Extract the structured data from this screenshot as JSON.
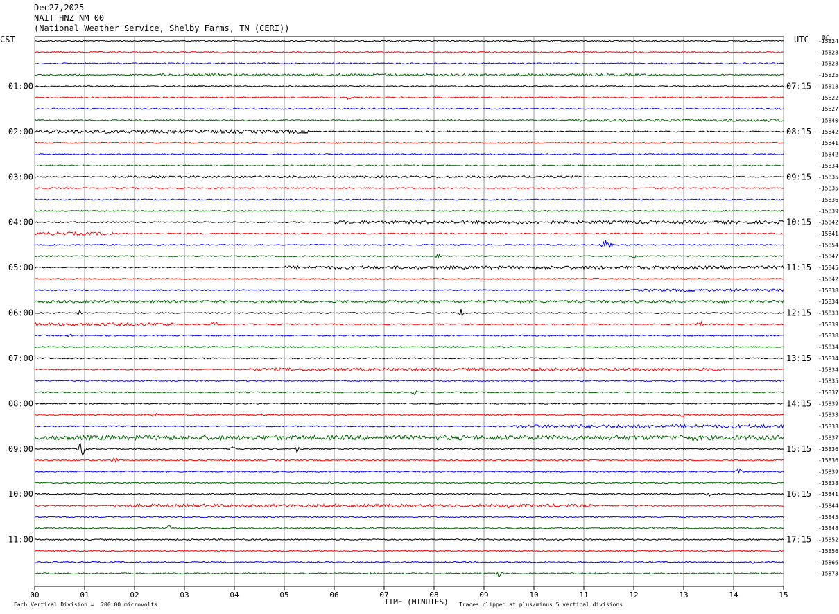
{
  "header": {
    "date": "Dec27,2025",
    "station": "NAIT HNZ NM 00",
    "location": "(National Weather Service, Shelby Farms, TN (CERI))"
  },
  "axes": {
    "left_tz": "CST",
    "right_tz": "UTC",
    "right_sub": "DC"
  },
  "footer": {
    "division_note": "Each Vertical Division =  200.00 microvolts",
    "xlabel": "TIME (MINUTES)",
    "clip_note": "Traces clipped at plus/minus 5 vertical divisions"
  },
  "colors": {
    "palette": [
      "#000000",
      "#ff0000",
      "#0000ff",
      "#006400"
    ],
    "grid": "#808080"
  },
  "chart_data": {
    "type": "seismogram",
    "xlabel": "TIME (MINUTES)",
    "x_ticks": [
      "00",
      "01",
      "02",
      "03",
      "04",
      "05",
      "06",
      "07",
      "08",
      "09",
      "10",
      "11",
      "12",
      "13",
      "14",
      "15"
    ],
    "x_range": [
      0,
      15
    ],
    "traces_per_hour": 4,
    "left_hour_labels": [
      "01:00",
      "02:00",
      "03:00",
      "04:00",
      "05:00",
      "06:00",
      "07:00",
      "08:00",
      "09:00",
      "10:00",
      "11:00"
    ],
    "right_hour_labels": [
      "07:15",
      "08:15",
      "09:15",
      "10:15",
      "11:15",
      "12:15",
      "13:15",
      "14:15",
      "15:15",
      "16:15",
      "17:15"
    ],
    "dc_offsets": [
      -15824,
      -15828,
      -15828,
      -15825,
      -15818,
      -15822,
      -15827,
      -15840,
      -15842,
      -15841,
      -15842,
      -15834,
      -15835,
      -15835,
      -15836,
      -15839,
      -15842,
      -15841,
      -15854,
      -15847,
      -15845,
      -15842,
      -15838,
      -15834,
      -15833,
      -15839,
      -15838,
      -15834,
      -15834,
      -15834,
      -15835,
      -15837,
      -15839,
      -15833,
      -15833,
      -15837,
      -15836,
      -15836,
      -15839,
      -15838,
      -15841,
      -15844,
      -15845,
      -15848,
      -15852,
      -15856,
      -15866,
      -15873
    ],
    "events": [
      {
        "trace": 3,
        "start": 2.5,
        "end": 12.5,
        "amp": 0.22
      },
      {
        "trace": 5,
        "start": 6.2,
        "end": 6.4,
        "amp": 0.5
      },
      {
        "trace": 7,
        "start": 10.8,
        "end": 15,
        "amp": 0.25
      },
      {
        "trace": 8,
        "start": 0,
        "end": 5.5,
        "amp": 0.35
      },
      {
        "trace": 12,
        "start": 1.6,
        "end": 11.0,
        "amp": 0.2
      },
      {
        "trace": 16,
        "start": 6.0,
        "end": 15,
        "amp": 0.3
      },
      {
        "trace": 17,
        "start": 0,
        "end": 1.6,
        "amp": 0.3
      },
      {
        "trace": 18,
        "start": 11.3,
        "end": 11.6,
        "amp": 1.2
      },
      {
        "trace": 19,
        "start": 8.0,
        "end": 8.2,
        "amp": 0.6
      },
      {
        "trace": 19,
        "start": 11.9,
        "end": 12.1,
        "amp": 0.5
      },
      {
        "trace": 20,
        "start": 5.0,
        "end": 15,
        "amp": 0.3
      },
      {
        "trace": 21,
        "start": 11.2,
        "end": 11.4,
        "amp": 0.6
      },
      {
        "trace": 22,
        "start": 12.0,
        "end": 15,
        "amp": 0.25
      },
      {
        "trace": 23,
        "start": 0,
        "end": 15,
        "amp": 0.25
      },
      {
        "trace": 24,
        "start": 8.5,
        "end": 8.6,
        "amp": 1.5
      },
      {
        "trace": 24,
        "start": 0.8,
        "end": 1.0,
        "amp": 0.6
      },
      {
        "trace": 25,
        "start": 0,
        "end": 2.8,
        "amp": 0.3
      },
      {
        "trace": 25,
        "start": 3.5,
        "end": 3.7,
        "amp": 0.8
      },
      {
        "trace": 25,
        "start": 13.2,
        "end": 13.5,
        "amp": 0.5
      },
      {
        "trace": 26,
        "start": 0.6,
        "end": 0.8,
        "amp": 0.5
      },
      {
        "trace": 29,
        "start": 4.3,
        "end": 13.8,
        "amp": 0.3
      },
      {
        "trace": 31,
        "start": 7.5,
        "end": 7.7,
        "amp": 0.5
      },
      {
        "trace": 33,
        "start": 2.3,
        "end": 2.5,
        "amp": 0.5
      },
      {
        "trace": 33,
        "start": 12.9,
        "end": 13.1,
        "amp": 0.6
      },
      {
        "trace": 34,
        "start": 9.6,
        "end": 15,
        "amp": 0.35
      },
      {
        "trace": 35,
        "start": 0,
        "end": 15,
        "amp": 0.45
      },
      {
        "trace": 35,
        "start": 13.0,
        "end": 13.4,
        "amp": 0.9
      },
      {
        "trace": 36,
        "start": 0.8,
        "end": 1.1,
        "amp": 1.4
      },
      {
        "trace": 36,
        "start": 5.2,
        "end": 5.3,
        "amp": 1.6
      },
      {
        "trace": 36,
        "start": 3.9,
        "end": 4.1,
        "amp": 0.8
      },
      {
        "trace": 37,
        "start": 1.5,
        "end": 1.7,
        "amp": 0.6
      },
      {
        "trace": 38,
        "start": 14.0,
        "end": 14.2,
        "amp": 0.6
      },
      {
        "trace": 39,
        "start": 5.8,
        "end": 6.0,
        "amp": 0.5
      },
      {
        "trace": 40,
        "start": 13.4,
        "end": 13.6,
        "amp": 0.5
      },
      {
        "trace": 41,
        "start": 1.6,
        "end": 11.2,
        "amp": 0.3
      },
      {
        "trace": 41,
        "start": 9.4,
        "end": 9.6,
        "amp": 0.7
      },
      {
        "trace": 43,
        "start": 2.6,
        "end": 2.8,
        "amp": 0.6
      },
      {
        "trace": 43,
        "start": 12.3,
        "end": 12.5,
        "amp": 0.5
      },
      {
        "trace": 46,
        "start": 14.3,
        "end": 14.5,
        "amp": 0.7
      },
      {
        "trace": 47,
        "start": 9.2,
        "end": 9.4,
        "amp": 0.8
      }
    ]
  }
}
